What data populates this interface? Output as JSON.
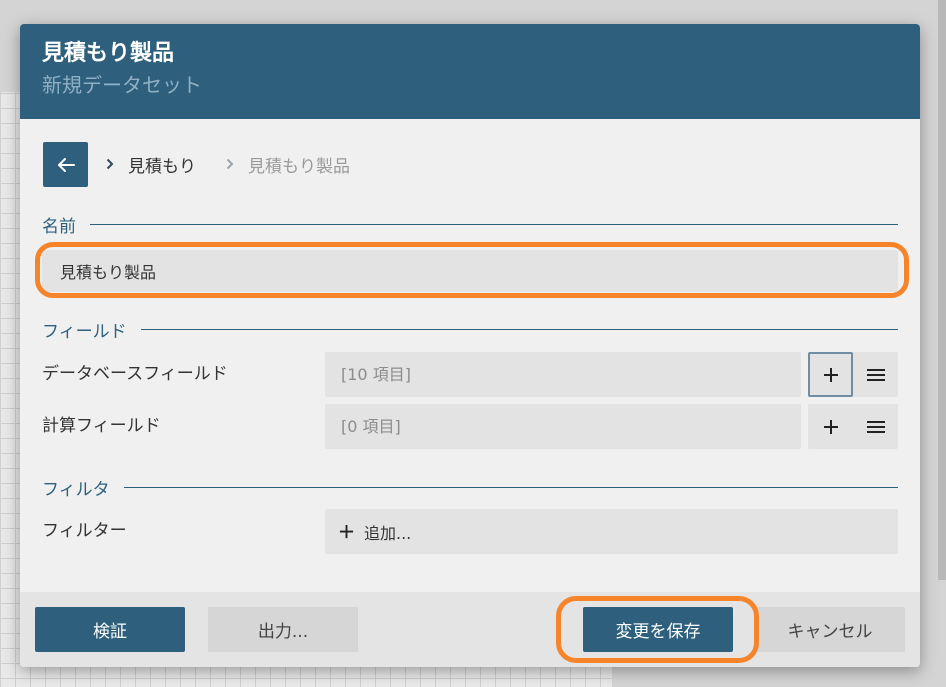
{
  "dialog": {
    "title": "見積もり製品",
    "subtitle": "新規データセット"
  },
  "breadcrumb": {
    "items": [
      "見積もり",
      "見積もり製品"
    ]
  },
  "name_section": {
    "label": "名前",
    "value": "見積もり製品"
  },
  "fields_section": {
    "label": "フィールド",
    "rows": [
      {
        "label": "データベースフィールド",
        "value": "[10 項目]"
      },
      {
        "label": "計算フィールド",
        "value": "[0 項目]"
      }
    ]
  },
  "filter_section": {
    "label": "フィルタ",
    "row_label": "フィルター",
    "add_label": "追加..."
  },
  "footer": {
    "validate_label": "検証",
    "export_label": "出力...",
    "save_label": "変更を保存",
    "cancel_label": "キャンセル"
  },
  "colors": {
    "primary": "#2e607d",
    "highlight": "#f6842a"
  },
  "icons": {
    "back": "arrow-left-icon",
    "separator": "chevron-right-icon",
    "add": "plus-icon",
    "menu": "hamburger-menu-icon"
  }
}
